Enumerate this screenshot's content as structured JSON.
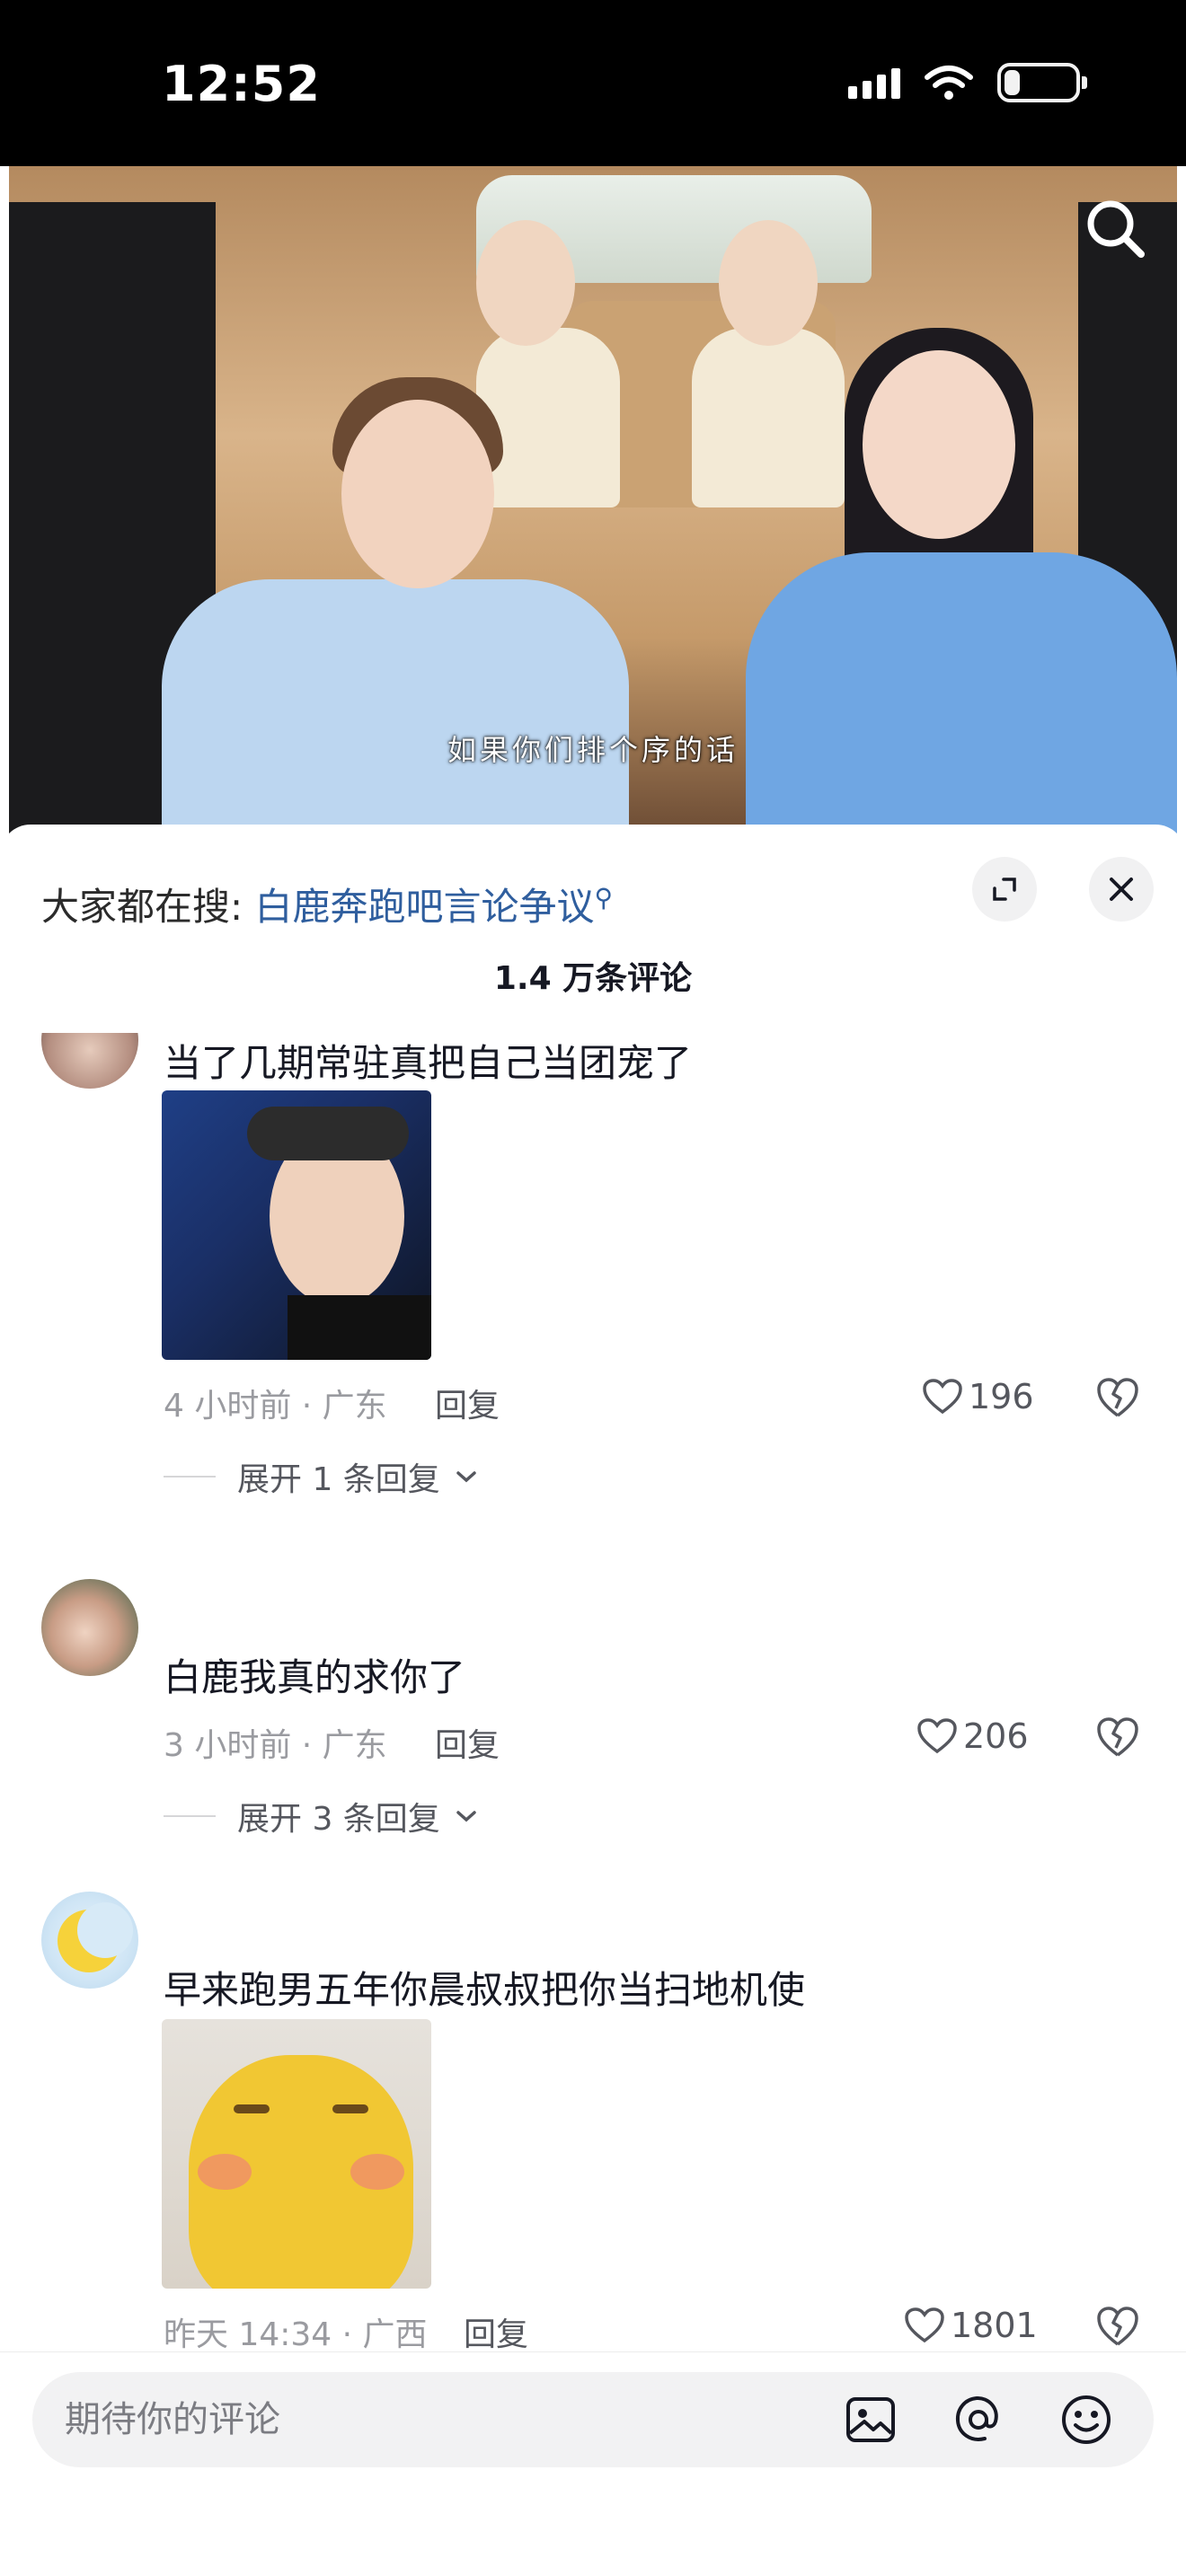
{
  "status_bar": {
    "time": "12:52",
    "battery_level": 0.22
  },
  "video": {
    "subtitle": "如果你们排个序的话",
    "search_icon": "search-icon"
  },
  "sheet": {
    "hot_search_prefix": "大家都在搜:",
    "hot_search_term": "白鹿奔跑吧言论争议",
    "comment_count": "1.4 万条评论",
    "expand_icon": "expand-icon",
    "close_icon": "close-icon"
  },
  "comments": [
    {
      "text": "当了几期常驻真把自己当团宠了",
      "time_location": "4 小时前 · 广东",
      "reply_label": "回复",
      "likes": "196",
      "expand_label": "展开 1 条回复"
    },
    {
      "text": "白鹿我真的求你了",
      "time_location": "3 小时前 · 广东",
      "reply_label": "回复",
      "likes": "206",
      "expand_label": "展开 3 条回复"
    },
    {
      "text": "早来跑男五年你晨叔叔把你当扫地机使",
      "time_location": "昨天 14:34 · 广西",
      "reply_label": "回复",
      "likes": "1801"
    }
  ],
  "input_bar": {
    "placeholder": "期待你的评论",
    "icons": [
      "image-icon",
      "at-icon",
      "emoji-icon"
    ]
  },
  "colors": {
    "accent_link": "#2f5e9e",
    "text_primary": "#161823",
    "text_secondary": "#9a9ba0"
  }
}
